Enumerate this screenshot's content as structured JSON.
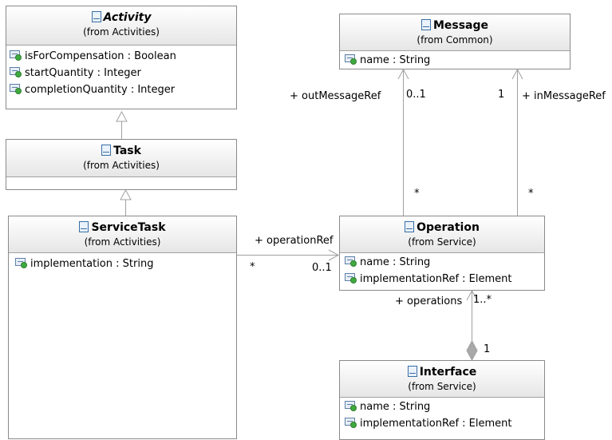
{
  "classes": {
    "activity": {
      "name": "Activity",
      "from": "(from Activities)",
      "attributes": [
        "isForCompensation : Boolean",
        "startQuantity : Integer",
        "completionQuantity : Integer"
      ]
    },
    "task": {
      "name": "Task",
      "from": "(from Activities)",
      "attributes": []
    },
    "service_task": {
      "name": "ServiceTask",
      "from": "(from Activities)",
      "attributes": [
        "implementation : String"
      ]
    },
    "message": {
      "name": "Message",
      "from": "(from Common)",
      "attributes": [
        "name : String"
      ]
    },
    "operation": {
      "name": "Operation",
      "from": "(from Service)",
      "attributes": [
        "name : String",
        "implementationRef : Element"
      ]
    },
    "interface": {
      "name": "Interface",
      "from": "(from Service)",
      "attributes": [
        "name : String",
        "implementationRef : Element"
      ]
    }
  },
  "associations": {
    "out_message_ref": {
      "role": "+ outMessageRef",
      "target_mult": "0..1",
      "source_mult": "*"
    },
    "in_message_ref": {
      "role": "+ inMessageRef",
      "target_mult": "1",
      "source_mult": "*"
    },
    "operation_ref": {
      "role": "+ operationRef",
      "source_mult": "*",
      "target_mult": "0..1"
    },
    "operations": {
      "role": "+ operations",
      "target_mult": "1..*",
      "source_mult": "1"
    }
  },
  "colors": {
    "border": "#8a8a8a",
    "header_gradient_end": "#e6e6e6",
    "edge": "#a0a0a0",
    "class_icon": "#3a6ea5",
    "attribute_dot": "#3faa3f"
  }
}
